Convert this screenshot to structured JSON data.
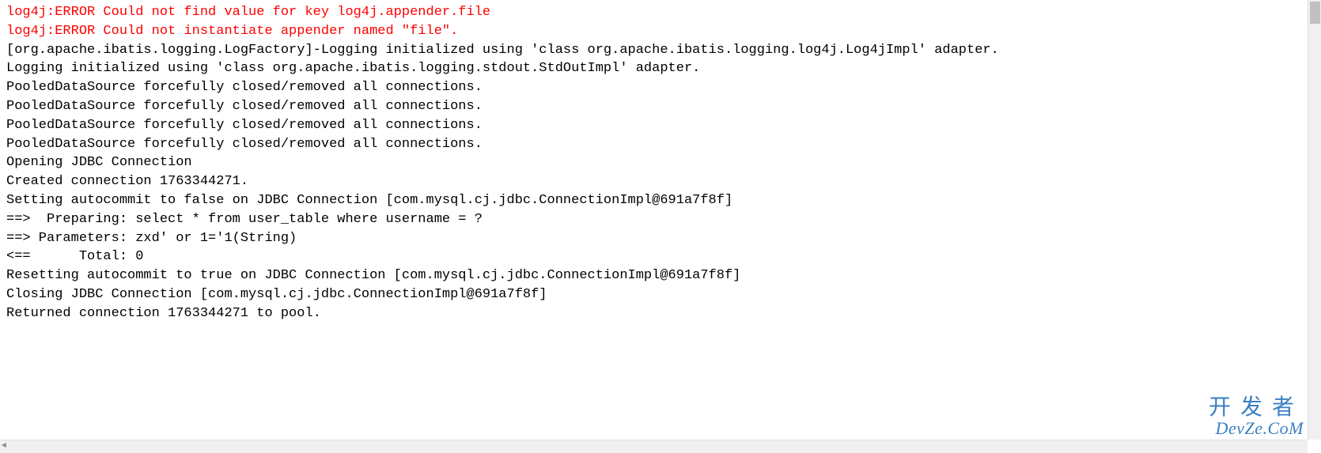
{
  "console": {
    "lines": [
      {
        "type": "error",
        "text": "log4j:ERROR Could not find value for key log4j.appender.file"
      },
      {
        "type": "error",
        "text": "log4j:ERROR Could not instantiate appender named \"file\"."
      },
      {
        "type": "normal",
        "text": "[org.apache.ibatis.logging.LogFactory]-Logging initialized using 'class org.apache.ibatis.logging.log4j.Log4jImpl' adapter."
      },
      {
        "type": "normal",
        "text": "Logging initialized using 'class org.apache.ibatis.logging.stdout.StdOutImpl' adapter."
      },
      {
        "type": "normal",
        "text": "PooledDataSource forcefully closed/removed all connections."
      },
      {
        "type": "normal",
        "text": "PooledDataSource forcefully closed/removed all connections."
      },
      {
        "type": "normal",
        "text": "PooledDataSource forcefully closed/removed all connections."
      },
      {
        "type": "normal",
        "text": "PooledDataSource forcefully closed/removed all connections."
      },
      {
        "type": "normal",
        "text": "Opening JDBC Connection"
      },
      {
        "type": "normal",
        "text": "Created connection 1763344271."
      },
      {
        "type": "normal",
        "text": "Setting autocommit to false on JDBC Connection [com.mysql.cj.jdbc.ConnectionImpl@691a7f8f]"
      },
      {
        "type": "normal",
        "text": "==>  Preparing: select * from user_table where username = ? "
      },
      {
        "type": "normal",
        "text": "==> Parameters: zxd' or 1='1(String)"
      },
      {
        "type": "normal",
        "text": "<==      Total: 0"
      },
      {
        "type": "normal",
        "text": "Resetting autocommit to true on JDBC Connection [com.mysql.cj.jdbc.ConnectionImpl@691a7f8f]"
      },
      {
        "type": "normal",
        "text": "Closing JDBC Connection [com.mysql.cj.jdbc.ConnectionImpl@691a7f8f]"
      },
      {
        "type": "normal",
        "text": "Returned connection 1763344271 to pool."
      }
    ]
  },
  "watermark": {
    "cn": "开发者",
    "en": "DevZe.CoM"
  },
  "colors": {
    "error": "#ff0000",
    "normal": "#000000",
    "watermark": "#3a7fc4"
  }
}
